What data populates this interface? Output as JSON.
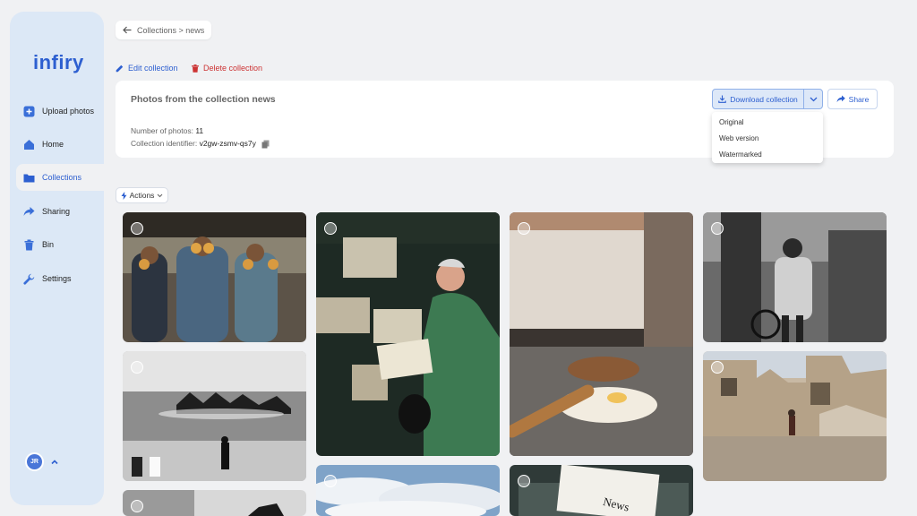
{
  "app": {
    "logo": "infiry"
  },
  "sidebar": {
    "items": [
      {
        "label": "Upload photos",
        "icon": "plus-square-icon"
      },
      {
        "label": "Home",
        "icon": "home-icon"
      },
      {
        "label": "Collections",
        "icon": "folder-icon"
      },
      {
        "label": "Sharing",
        "icon": "share-arrow-icon"
      },
      {
        "label": "Bin",
        "icon": "trash-icon"
      },
      {
        "label": "Settings",
        "icon": "wrench-icon"
      }
    ],
    "active": "Collections",
    "user_initials": "JR"
  },
  "breadcrumb": {
    "text": "Collections > news"
  },
  "collection_actions": {
    "edit": "Edit collection",
    "delete": "Delete collection"
  },
  "card": {
    "title": "Photos from the collection news",
    "photos_label": "Number of photos:",
    "photos_count": "11",
    "identifier_label": "Collection identifier:",
    "identifier": "v2gw-zsmv-qs7y"
  },
  "download": {
    "label": "Download collection",
    "options": [
      "Original",
      "Web version",
      "Watermarked"
    ]
  },
  "share": {
    "label": "Share"
  },
  "actions": {
    "label": "Actions"
  },
  "photos": [
    {
      "subject": "Three men in aprons holding bread rings over their eyes"
    },
    {
      "subject": "Older man reading newspaper at a newsstand"
    },
    {
      "subject": "Flour and egg with rolling pin on a counter"
    },
    {
      "subject": "Man walking with a bicycle, black and white"
    },
    {
      "subject": "Horse race through water, black and white"
    },
    {
      "subject": "Damaged buildings with a person walking"
    },
    {
      "subject": "Sky with clouds"
    },
    {
      "subject": "Typewriter with paper reading News"
    },
    {
      "subject": "Black and white photo, partially visible"
    }
  ],
  "colors": {
    "accent": "#2d5fd0",
    "danger": "#cc3333",
    "sidebar": "#dce8f6",
    "background": "#f0f1f3"
  }
}
